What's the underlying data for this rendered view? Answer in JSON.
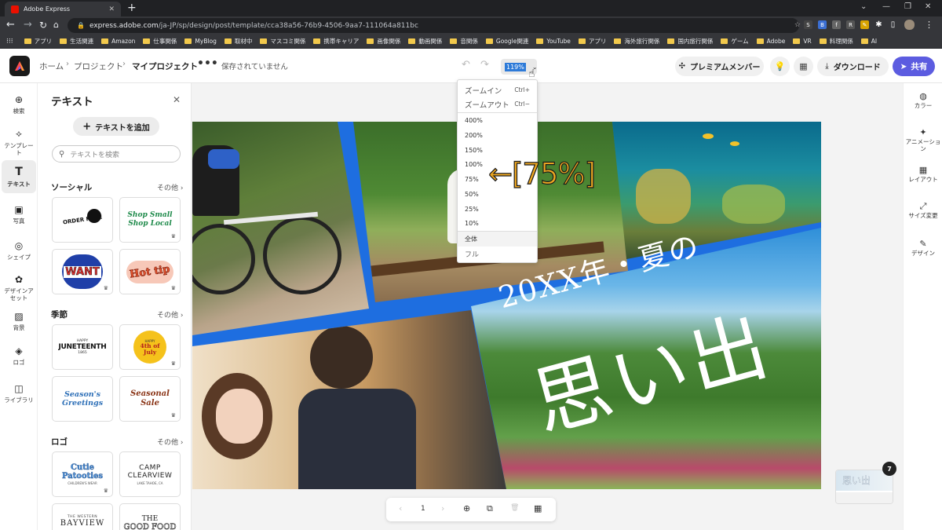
{
  "browser": {
    "tab_title": "Adobe Express",
    "tab_close": "✕",
    "new_tab": "+",
    "url_host": "express.adobe.com",
    "url_path": "/ja-JP/sp/design/post/template/cca38a56-76b9-4506-9aa7-111064a811bc",
    "bookmarks": [
      "アプリ",
      "生活関連",
      "Amazon",
      "仕事関係",
      "MyBlog",
      "取材中",
      "マスコミ関係",
      "携帯キャリア",
      "画像関係",
      "動画関係",
      "音関係",
      "Google関連",
      "YouTube",
      "アプリ",
      "海外旅行関係",
      "国内旅行関係",
      "ゲーム",
      "Adobe",
      "VR",
      "料理関係",
      "AI"
    ]
  },
  "header": {
    "breadcrumb_home": "ホーム",
    "breadcrumb_projects": "プロジェクト",
    "breadcrumb_my_projects": "マイプロジェクト",
    "more": "•••",
    "save_status": "保存されていません",
    "zoom_value": "119%",
    "premium_label": "プレミアムメンバー",
    "download_label": "ダウンロード",
    "share_label": "共有"
  },
  "left_rail": [
    {
      "label": "検索",
      "icon": "⊕"
    },
    {
      "label": "テンプレート",
      "icon": "⟡"
    },
    {
      "label": "テキスト",
      "icon": "T"
    },
    {
      "label": "写真",
      "icon": "▣"
    },
    {
      "label": "シェイプ",
      "icon": "◎"
    },
    {
      "label": "デザインアセット",
      "icon": "✿"
    },
    {
      "label": "背景",
      "icon": "▨"
    },
    {
      "label": "ロゴ",
      "icon": "◈"
    },
    {
      "label": "ライブラリ",
      "icon": "◫"
    }
  ],
  "panel": {
    "title": "テキスト",
    "add_text": "テキストを追加",
    "search_placeholder": "テキストを検索",
    "more_label": "その他",
    "sections": [
      {
        "name": "ソーシャル",
        "items": [
          "ORDER HERE",
          "Shop Small Shop Local",
          "WANT",
          "Hot tip"
        ]
      },
      {
        "name": "季節",
        "items": [
          "HAPPY",
          "JUNETEENTH",
          "1865",
          "HAPPY",
          "4th of July",
          "Season's Greetings",
          "Seasonal Sale"
        ]
      },
      {
        "name": "ロゴ",
        "items": [
          "Cutie Patooties",
          "CHILDREN'S WEAR",
          "CAMP CLEARVIEW",
          "LAKE TAHOE, CA",
          "THE WESTERN",
          "BAYVIEW",
          "THE",
          "GOOD FOOD"
        ]
      }
    ]
  },
  "canvas": {
    "title_line1": "20XX年・夏の",
    "title_line2": "思い出"
  },
  "zoom_menu": {
    "zoom_in": "ズームイン",
    "zoom_in_key": "Ctrl+",
    "zoom_out": "ズームアウト",
    "zoom_out_key": "Ctrl−",
    "levels": [
      "400%",
      "200%",
      "150%",
      "100%",
      "75%",
      "50%",
      "25%",
      "10%"
    ],
    "fit_all": "全体",
    "fit_full": "フル"
  },
  "annotation": "←[75%]",
  "right_rail": [
    {
      "label": "カラー",
      "icon": "◍"
    },
    {
      "label": "アニメーション",
      "icon": "✦"
    },
    {
      "label": "レイアウト",
      "icon": "▦"
    },
    {
      "label": "サイズ変更",
      "icon": "⤢"
    },
    {
      "label": "デザイン",
      "icon": "✎"
    }
  ],
  "page_controls": {
    "page_number": "1",
    "prev": "‹",
    "next": "›",
    "add": "⊕",
    "duplicate": "⧉",
    "delete": "🗑",
    "grid": "▦"
  },
  "thumbnail": {
    "badge": "7",
    "caption": "思い出"
  },
  "colors": {
    "accent": "#5c5ce0",
    "canvas_blue": "#1e6ee0",
    "annotation": "#f0a820"
  }
}
